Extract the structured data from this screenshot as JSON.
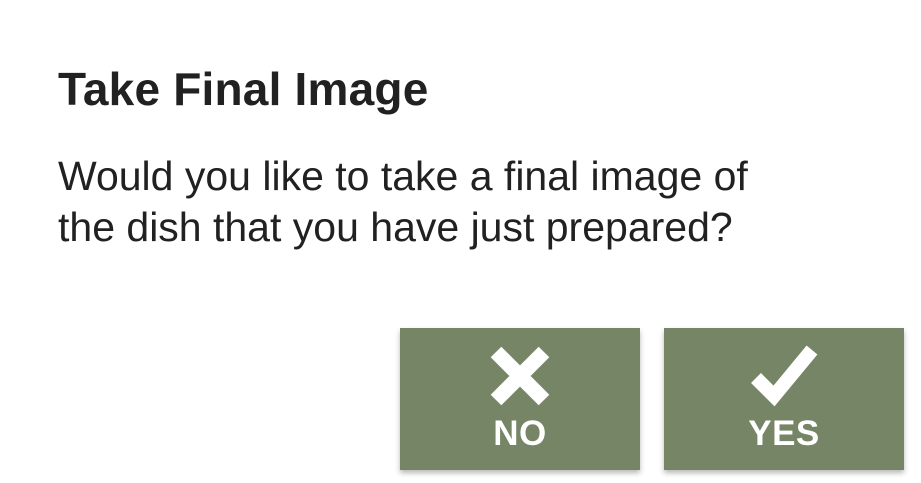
{
  "dialog": {
    "title": "Take Final Image",
    "message_lines": [
      "Would you like to take a final image of",
      "the dish that you have just prepared?"
    ]
  },
  "buttons": {
    "no": {
      "label": "NO",
      "icon": "close-icon"
    },
    "yes": {
      "label": "YES",
      "icon": "check-icon"
    }
  },
  "colors": {
    "button_background": "#768566",
    "button_text": "#ffffff",
    "text": "#212121",
    "background": "#ffffff"
  }
}
